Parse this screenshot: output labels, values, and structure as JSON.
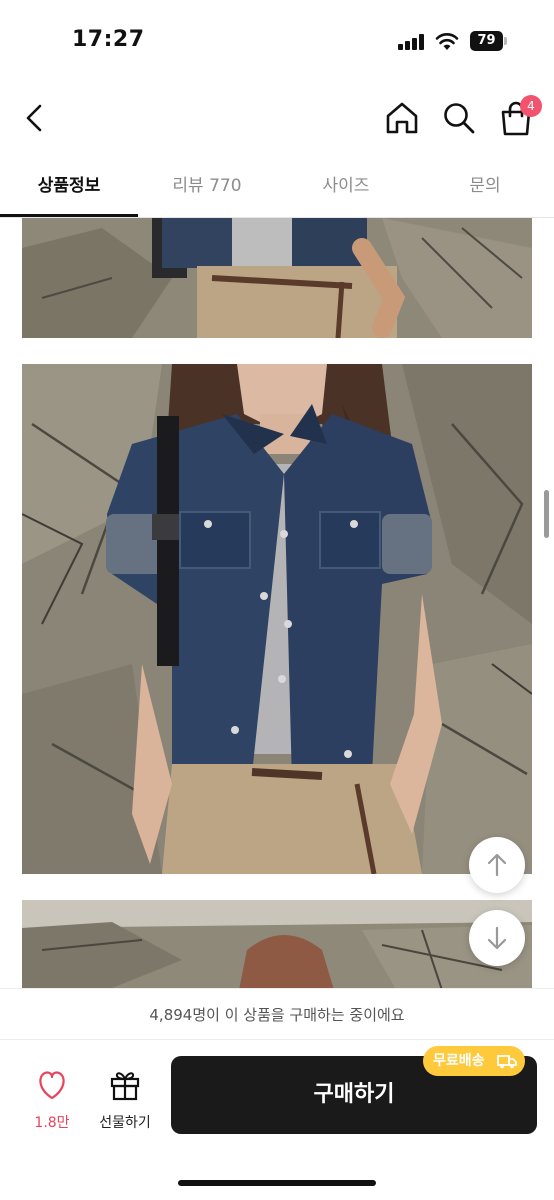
{
  "status": {
    "time": "17:27",
    "battery": "79"
  },
  "nav": {
    "cart_count": "4"
  },
  "tabs": [
    {
      "label": "상품정보"
    },
    {
      "label": "리뷰 770"
    },
    {
      "label": "사이즈"
    },
    {
      "label": "문의"
    }
  ],
  "active_tab": "상품정보",
  "footer": {
    "buyers_notice": "4,894명이 이 상품을 구매하는 중이에요",
    "like_count": "1.8만",
    "gift_label": "선물하기",
    "buy_label": "구매하기",
    "shipping_badge": "무료배송"
  },
  "colors": {
    "accent": "#f2536e",
    "buy_button": "#1a1a1a",
    "shipping_badge": "#ffc93c"
  }
}
